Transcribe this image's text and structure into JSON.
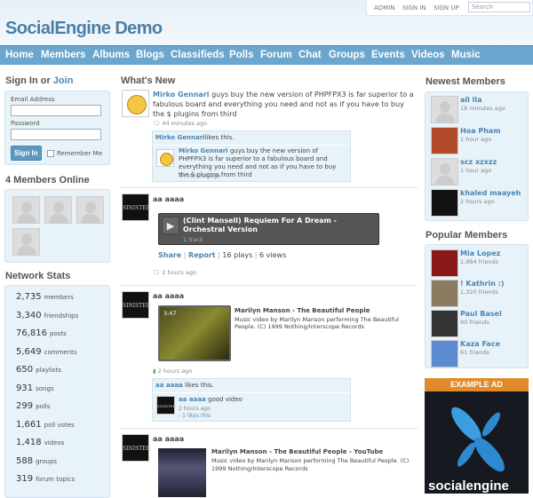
{
  "header": {
    "site_title": "SocialEngine Demo",
    "top_links": [
      "ADMIN",
      "SIGN IN",
      "SIGN UP"
    ],
    "search_placeholder": "Search"
  },
  "nav": [
    "Home",
    "Members",
    "Albums",
    "Blogs",
    "Classifieds",
    "Polls",
    "Forum",
    "Chat",
    "Groups",
    "Events",
    "Videos",
    "Music"
  ],
  "signin": {
    "title_prefix": "Sign In or",
    "join": "Join",
    "email_label": "Email Address",
    "password_label": "Password",
    "button": "Sign In",
    "remember": "Remember Me"
  },
  "online": {
    "title": "4 Members Online"
  },
  "stats": {
    "title": "Network Stats",
    "items": [
      {
        "value": "2,735",
        "label": "members"
      },
      {
        "value": "3,340",
        "label": "friendships"
      },
      {
        "value": "76,816",
        "label": "posts"
      },
      {
        "value": "5,649",
        "label": "comments"
      },
      {
        "value": "650",
        "label": "playlists"
      },
      {
        "value": "931",
        "label": "songs"
      },
      {
        "value": "299",
        "label": "polls"
      },
      {
        "value": "1,661",
        "label": "poll votes"
      },
      {
        "value": "1,418",
        "label": "videos"
      },
      {
        "value": "588",
        "label": "groups"
      },
      {
        "value": "319",
        "label": "forum topics"
      }
    ]
  },
  "feed": {
    "title": "What's New",
    "items": [
      {
        "user": "Mirko Gennari",
        "text": "guys buy the new version of PHPFPX3 is far superior to a fabulous board and everything you need and not as if you have to buy the $ plugins from third",
        "time": "44 minutes ago",
        "likes_user": "Mirko Gennari",
        "likes_text": "likes this.",
        "comment_user": "Mirko Gennari",
        "comment_text": "guys buy the new version of PHPFPX3 is far superior to a fabulous board and everything you need and not as if you have to buy the $ plugins from third",
        "comment_time": "44 minutes ago"
      },
      {
        "user": "aa aaaa",
        "player_title": "(Clint Mansell) Requiem For A Dream - Orchestral Version",
        "player_sub": "1 track",
        "share": "Share",
        "report": "Report",
        "plays": "16 plays",
        "views": "6 views",
        "time": "2 hours ago"
      },
      {
        "user": "aa aaaa",
        "video_title": "Marilyn Manson - The Beautiful People",
        "video_desc": "Music video by Marilyn Manson performing The Beautiful People. (C) 1999 Nothing/Interscope Records",
        "duration": "3:47",
        "time": "2 hours ago",
        "likes_user": "aa aaaa",
        "likes_text": "likes this.",
        "comment_user": "aa aaaa",
        "comment_text": "good video",
        "comment_time": "2 hours ago",
        "comment_likes": "- 1 likes this"
      },
      {
        "user": "aa aaaa",
        "video_title": "Marilyn Manson - The Beautiful People - YouTube",
        "video_desc": "Music video by Marilyn Manson performing The Beautiful People. (C) 1999 Nothing/Interscope Records"
      }
    ]
  },
  "newest": {
    "title": "Newest Members",
    "items": [
      {
        "name": "all lla",
        "sub": "18 minutes ago"
      },
      {
        "name": "Hoa Pham",
        "sub": "1 hour ago"
      },
      {
        "name": "scz xzxzz",
        "sub": "1 hour ago"
      },
      {
        "name": "khaled maayeh",
        "sub": "2 hours ago"
      }
    ]
  },
  "popular": {
    "title": "Popular Members",
    "items": [
      {
        "name": "Mia Lopez",
        "sub": "1,984 friends"
      },
      {
        "name": "! Kathrin :)",
        "sub": "1,320 friends"
      },
      {
        "name": "Paul Basel",
        "sub": "90 friends"
      },
      {
        "name": "Kaza Face",
        "sub": "61 friends"
      }
    ]
  },
  "ad": {
    "title": "EXAMPLE AD",
    "logo_text": "socialengine",
    "accent": "#e08a2a"
  },
  "colors": {
    "nav": "#6aa6cd",
    "link": "#4a86b4",
    "box": "#e8f2f9"
  }
}
